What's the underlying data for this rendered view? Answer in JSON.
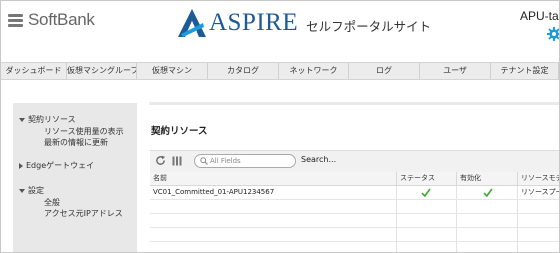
{
  "header": {
    "softbank_logo": "SoftBank",
    "aspire_logo": "ASPIRE",
    "portal_subtitle": "セルフポータルサイト",
    "user_label": "APU-ta",
    "gear_icon": "gear-icon",
    "brand_color": "#1d5a96",
    "accent_color": "#1b9be0"
  },
  "nav": {
    "items": [
      {
        "label": "ダッシュボード"
      },
      {
        "label": "仮想マシングループ"
      },
      {
        "label": "仮想マシン"
      },
      {
        "label": "カタログ"
      },
      {
        "label": "ネットワーク"
      },
      {
        "label": "ログ"
      },
      {
        "label": "ユーザ"
      },
      {
        "label": "テナント設定"
      }
    ]
  },
  "sidebar": {
    "groups": [
      {
        "label": "契約リソース",
        "expanded": true,
        "items": [
          {
            "label": "リソース使用量の表示"
          },
          {
            "label": "最新の情報に更新"
          }
        ]
      },
      {
        "label": "Edgeゲートウェイ",
        "expanded": false,
        "items": []
      },
      {
        "label": "設定",
        "expanded": true,
        "items": [
          {
            "label": "全般"
          },
          {
            "label": "アクセス元IPアドレス"
          }
        ]
      }
    ]
  },
  "main": {
    "title": "契約リソース",
    "toolbar": {
      "refresh_icon": "refresh-icon",
      "columns_icon": "columns-icon",
      "search_placeholder": "All Fields",
      "search_button": "Search..."
    },
    "table": {
      "columns": [
        "名前",
        "ステータス",
        "有効化",
        "リソースモデル"
      ],
      "rows": [
        {
          "name": "VC01_Committed_01-APU1234567",
          "status": "check",
          "enabled": "check",
          "model": "リソースプール"
        }
      ],
      "check_color": "#3aa82e"
    }
  }
}
